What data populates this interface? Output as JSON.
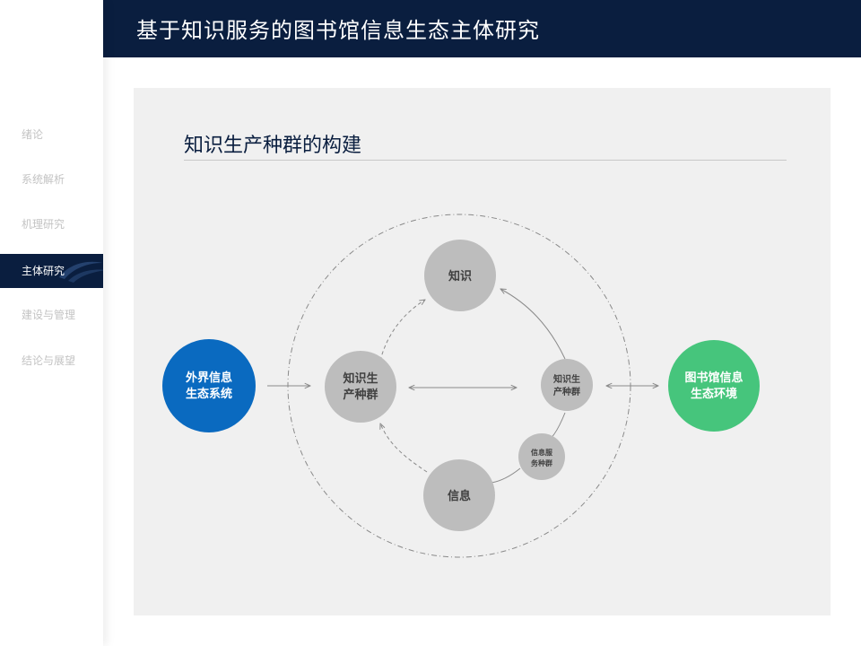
{
  "header": {
    "title": "基于知识服务的图书馆信息生态主体研究"
  },
  "sidebar": {
    "items": [
      {
        "label": "绪论",
        "active": false
      },
      {
        "label": "系统解析",
        "active": false
      },
      {
        "label": "机理研究",
        "active": false
      },
      {
        "label": "主体研究",
        "active": true
      },
      {
        "label": "建设与管理",
        "active": false
      },
      {
        "label": "结论与展望",
        "active": false
      }
    ]
  },
  "panel": {
    "title": "知识生产种群的构建"
  },
  "diagram": {
    "nodes": {
      "external": {
        "lines": [
          "外界信息",
          "生态系统"
        ],
        "color": "#0a6ac0"
      },
      "producer_left": {
        "lines": [
          "知识生",
          "产种群"
        ],
        "color": "#bdbdbd"
      },
      "knowledge": {
        "lines": [
          "知识"
        ],
        "color": "#bdbdbd"
      },
      "information": {
        "lines": [
          "信息"
        ],
        "color": "#bdbdbd"
      },
      "producer_right": {
        "lines": [
          "知识生",
          "产种群"
        ],
        "color": "#bdbdbd"
      },
      "service": {
        "lines": [
          "信息服",
          "务种群"
        ],
        "color": "#bdbdbd"
      },
      "library": {
        "lines": [
          "图书馆信息",
          "生态环境"
        ],
        "color": "#46c57c"
      }
    }
  }
}
